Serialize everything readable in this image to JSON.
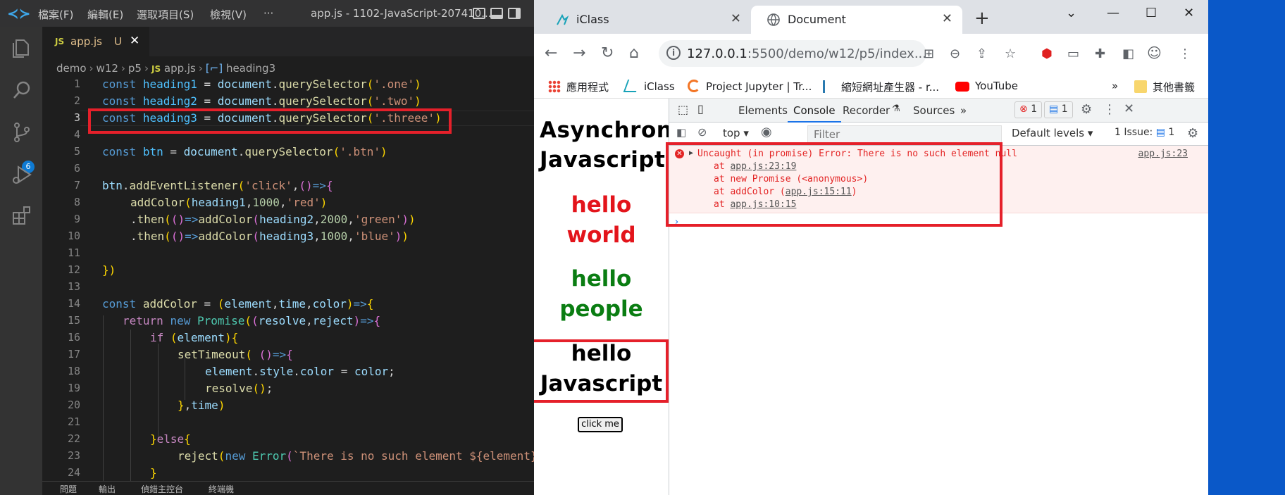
{
  "vscode": {
    "menus": [
      "檔案(F)",
      "編輯(E)",
      "選取項目(S)",
      "檢視(V)",
      "···"
    ],
    "window_title": "app.js - 1102-JavaScript-207410...",
    "activity_badge": "6",
    "tab": {
      "lang": "JS",
      "name": "app.js",
      "status": "U",
      "close": "✕"
    },
    "breadcrumb": [
      "demo",
      "w12",
      "p5",
      "app.js",
      "heading3"
    ],
    "breadcrumb_lang": "JS",
    "line_numbers": [
      "1",
      "2",
      "3",
      "4",
      "5",
      "6",
      "7",
      "8",
      "9",
      "10",
      "11",
      "12",
      "13",
      "14",
      "15",
      "16",
      "17",
      "18",
      "19",
      "20",
      "21",
      "22",
      "23",
      "24"
    ],
    "code": {
      "l1": "const heading1 = document.querySelector('.one')",
      "l2": "const heading2 = document.querySelector('.two')",
      "l3": "const heading3 = document.querySelector('.threee')",
      "l5": "const btn = document.querySelector('.btn')",
      "l7": "btn.addEventListener('click',()=>{",
      "l8": "addColor(heading1,1000,'red')",
      "l9": ".then(()=>addColor(heading2,2000,'green'))",
      "l10": ".then(()=>addColor(heading3,1000,'blue'))",
      "l12": "})",
      "l14": "const addColor = (element,time,color)=>{",
      "l15": "return new Promise((resolve,reject)=>{",
      "l16": "if (element){",
      "l17": "setTimeout( ()=>{",
      "l18": "element.style.color = color;",
      "l19": "resolve();",
      "l20": "},time)",
      "l22": "}else{",
      "l23": "reject(new Error(`There is no such element ${element}",
      "l24": "}"
    },
    "panel_tabs": [
      "問題",
      "輸出",
      "偵錯主控台",
      "終端機"
    ]
  },
  "chrome": {
    "tabs": [
      {
        "title": "iClass",
        "close": "✕"
      },
      {
        "title": "Document",
        "close": "✕"
      }
    ],
    "new_tab": "+",
    "window_controls": [
      "⌄",
      "—",
      "☐",
      "✕"
    ],
    "url_host": "127.0.0.1",
    "url_rest": ":5500/demo/w12/p5/index....",
    "bookmarks": [
      "應用程式",
      "iClass",
      "Project Jupyter | Tr...",
      "縮短網址產生器 - r...",
      "YouTube"
    ],
    "bookmarks_more": "»",
    "other_bookmarks": "其他書籤",
    "page": {
      "heading": "Asynchronous Javascript",
      "h1": "hello world",
      "h2": "hello people",
      "h3": "hello Javascript",
      "button": "click me",
      "colors": {
        "h1": "#e3141b",
        "h2": "#0a7d12",
        "h3": "#000000"
      }
    },
    "devtools": {
      "tabs": [
        "Elements",
        "Console",
        "Recorder",
        "Sources"
      ],
      "more": "»",
      "error_count": "1",
      "message_count": "1",
      "context": "top",
      "filter_placeholder": "Filter",
      "levels": "Default levels",
      "issues_label": "1 Issue:",
      "issues_count": "1",
      "error": {
        "message": "Uncaught (in promise) Error: There is no such element null",
        "source": "app.js:23",
        "stack": [
          {
            "prefix": "at ",
            "link": "app.js:23:19",
            "suffix": ""
          },
          {
            "prefix": "at new Promise (<anonymous>)",
            "link": "",
            "suffix": ""
          },
          {
            "prefix": "at addColor (",
            "link": "app.js:15:11",
            "suffix": ")"
          },
          {
            "prefix": "at ",
            "link": "app.js:10:15",
            "suffix": ""
          }
        ]
      },
      "prompt": "›"
    }
  },
  "accent": {
    "vscode_blue": "#0e7ad3",
    "highlight_red": "#e5202a",
    "devtools_blue": "#1a73e8",
    "desktop_blue": "#0a58c8"
  }
}
